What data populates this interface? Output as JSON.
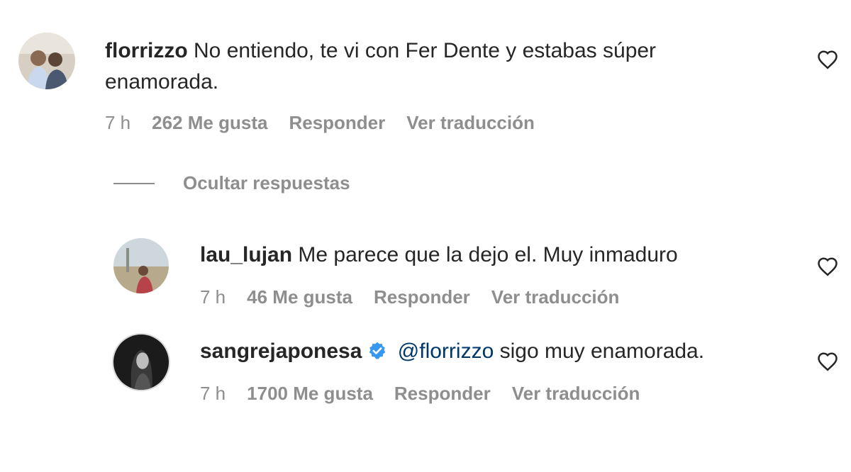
{
  "comments": [
    {
      "username": "florrizzo",
      "text": "No entiendo, te vi con Fer Dente y estabas súper",
      "text_line2": "enamorada.",
      "time": "7 h",
      "likes": "262 Me gusta",
      "reply": "Responder",
      "translate": "Ver traducción"
    }
  ],
  "hide_replies": "Ocultar respuestas",
  "replies": [
    {
      "username": "lau_lujan",
      "text": "Me parece que la dejo el. Muy inmaduro",
      "time": "7 h",
      "likes": "46 Me gusta",
      "reply": "Responder",
      "translate": "Ver traducción"
    },
    {
      "username": "sangrejaponesa",
      "verified": true,
      "mention": "@florrizzo",
      "text": "sigo muy enamorada.",
      "time": "7 h",
      "likes": "1700 Me gusta",
      "reply": "Responder",
      "translate": "Ver traducción"
    }
  ],
  "icons": {
    "like": "heart-outline-icon",
    "verified": "verified-badge-icon"
  },
  "colors": {
    "text": "#262626",
    "secondary": "#8e8e8e",
    "mention": "#00376b",
    "verified": "#3897f0"
  }
}
